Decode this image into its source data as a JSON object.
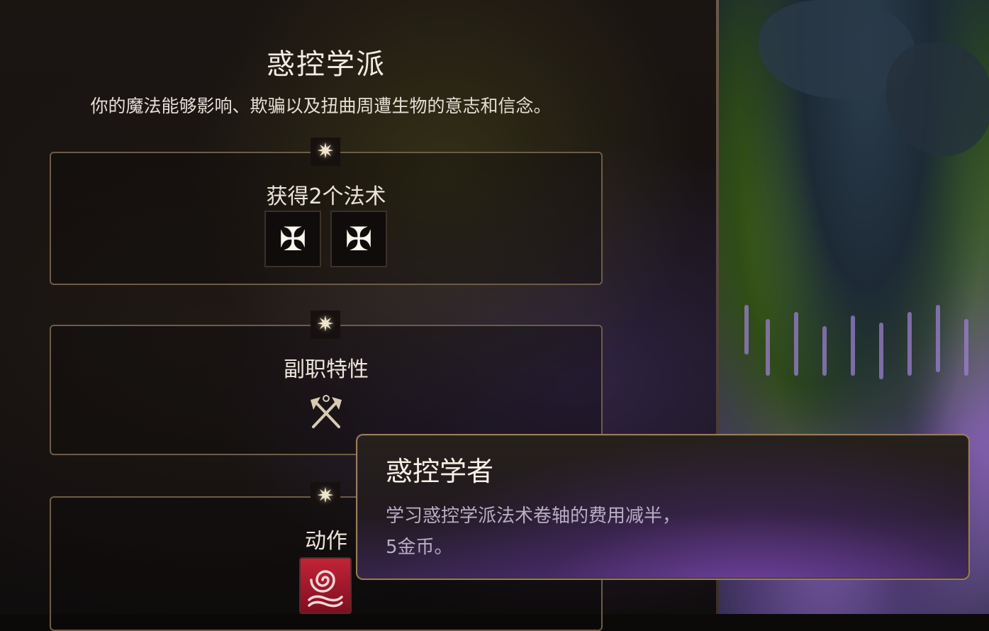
{
  "school": {
    "title": "惑控学派",
    "description": "你的魔法能够影响、欺骗以及扭曲周遭生物的意志和信念。"
  },
  "sections": {
    "spells": {
      "label": "获得2个法术",
      "slot_icons": [
        "cross-pattee-icon",
        "cross-pattee-icon"
      ]
    },
    "passive": {
      "label": "副职特性",
      "icon": "crossed-axes-icon"
    },
    "action": {
      "label": "动作",
      "icon": "spiral-icon"
    }
  },
  "tooltip": {
    "title": "惑控学者",
    "body": "学习惑控学派法术卷轴的费用减半，\n5金币。"
  },
  "colors": {
    "accent_border": "#6e5b48",
    "text_primary": "#f2ece4",
    "tooltip_body": "#b9adc6",
    "action_icon_bg": "#c32337"
  }
}
